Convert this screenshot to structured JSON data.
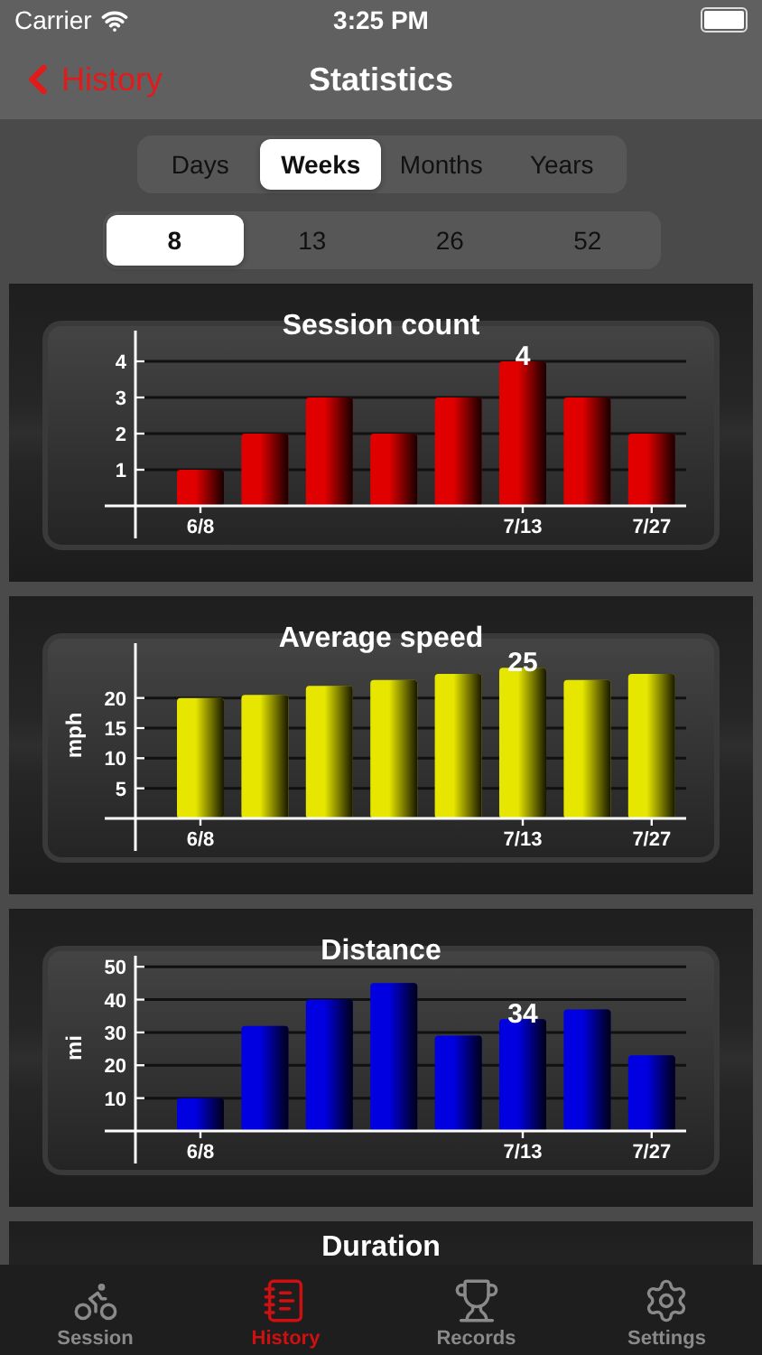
{
  "status_bar": {
    "carrier": "Carrier",
    "time": "3:25 PM"
  },
  "nav": {
    "back": "History",
    "title": "Statistics"
  },
  "period_tabs": [
    {
      "label": "Days",
      "selected": false
    },
    {
      "label": "Weeks",
      "selected": true
    },
    {
      "label": "Months",
      "selected": false
    },
    {
      "label": "Years",
      "selected": false
    }
  ],
  "range_tabs": [
    {
      "label": "8",
      "selected": true
    },
    {
      "label": "13",
      "selected": false
    },
    {
      "label": "26",
      "selected": false
    },
    {
      "label": "52",
      "selected": false
    }
  ],
  "charts": [
    {
      "chart_data": {
        "type": "bar",
        "title": "Session count",
        "categories": [
          "6/8",
          null,
          null,
          null,
          null,
          "7/13",
          null,
          "7/27"
        ],
        "ylim": [
          0,
          5
        ],
        "yticks": [
          1,
          2,
          3,
          4
        ],
        "series": [
          {
            "color": "#e00000",
            "values": [
              1,
              2,
              3,
              2,
              3,
              4,
              3,
              2
            ]
          }
        ],
        "grid": true,
        "annotations": [
          {
            "x": "7/13",
            "text": "4"
          }
        ]
      }
    },
    {
      "chart_data": {
        "type": "bar",
        "title": "Average speed",
        "ylabel": "mph",
        "categories": [
          "6/8",
          null,
          null,
          null,
          null,
          "7/13",
          null,
          "7/27"
        ],
        "ylim": [
          0,
          30
        ],
        "yticks": [
          5,
          10,
          15,
          20
        ],
        "series": [
          {
            "color": "#e6e600",
            "values": [
              20,
              20.5,
              22,
              23,
              24,
              25,
              23,
              24
            ]
          }
        ],
        "grid": true,
        "annotations": [
          {
            "x": "7/13",
            "text": "25"
          }
        ]
      }
    },
    {
      "chart_data": {
        "type": "bar",
        "title": "Distance",
        "ylabel": "mi",
        "categories": [
          "6/8",
          null,
          null,
          null,
          null,
          "7/13",
          null,
          "7/27"
        ],
        "ylim": [
          0,
          55
        ],
        "yticks": [
          10,
          20,
          30,
          40,
          50
        ],
        "series": [
          {
            "color": "#0000e0",
            "values": [
              10,
              32,
              40,
              45,
              29,
              34,
              37,
              23
            ]
          }
        ],
        "grid": true,
        "annotations": [
          {
            "x": "7/13",
            "text": "34"
          }
        ]
      }
    }
  ],
  "partial_chart": {
    "title": "Duration"
  },
  "tab_bar": [
    {
      "label": "Session",
      "kind": "bike",
      "selected": false
    },
    {
      "label": "History",
      "kind": "notebook",
      "selected": true
    },
    {
      "label": "Records",
      "kind": "trophy",
      "selected": false
    },
    {
      "label": "Settings",
      "kind": "gear",
      "selected": false
    }
  ]
}
